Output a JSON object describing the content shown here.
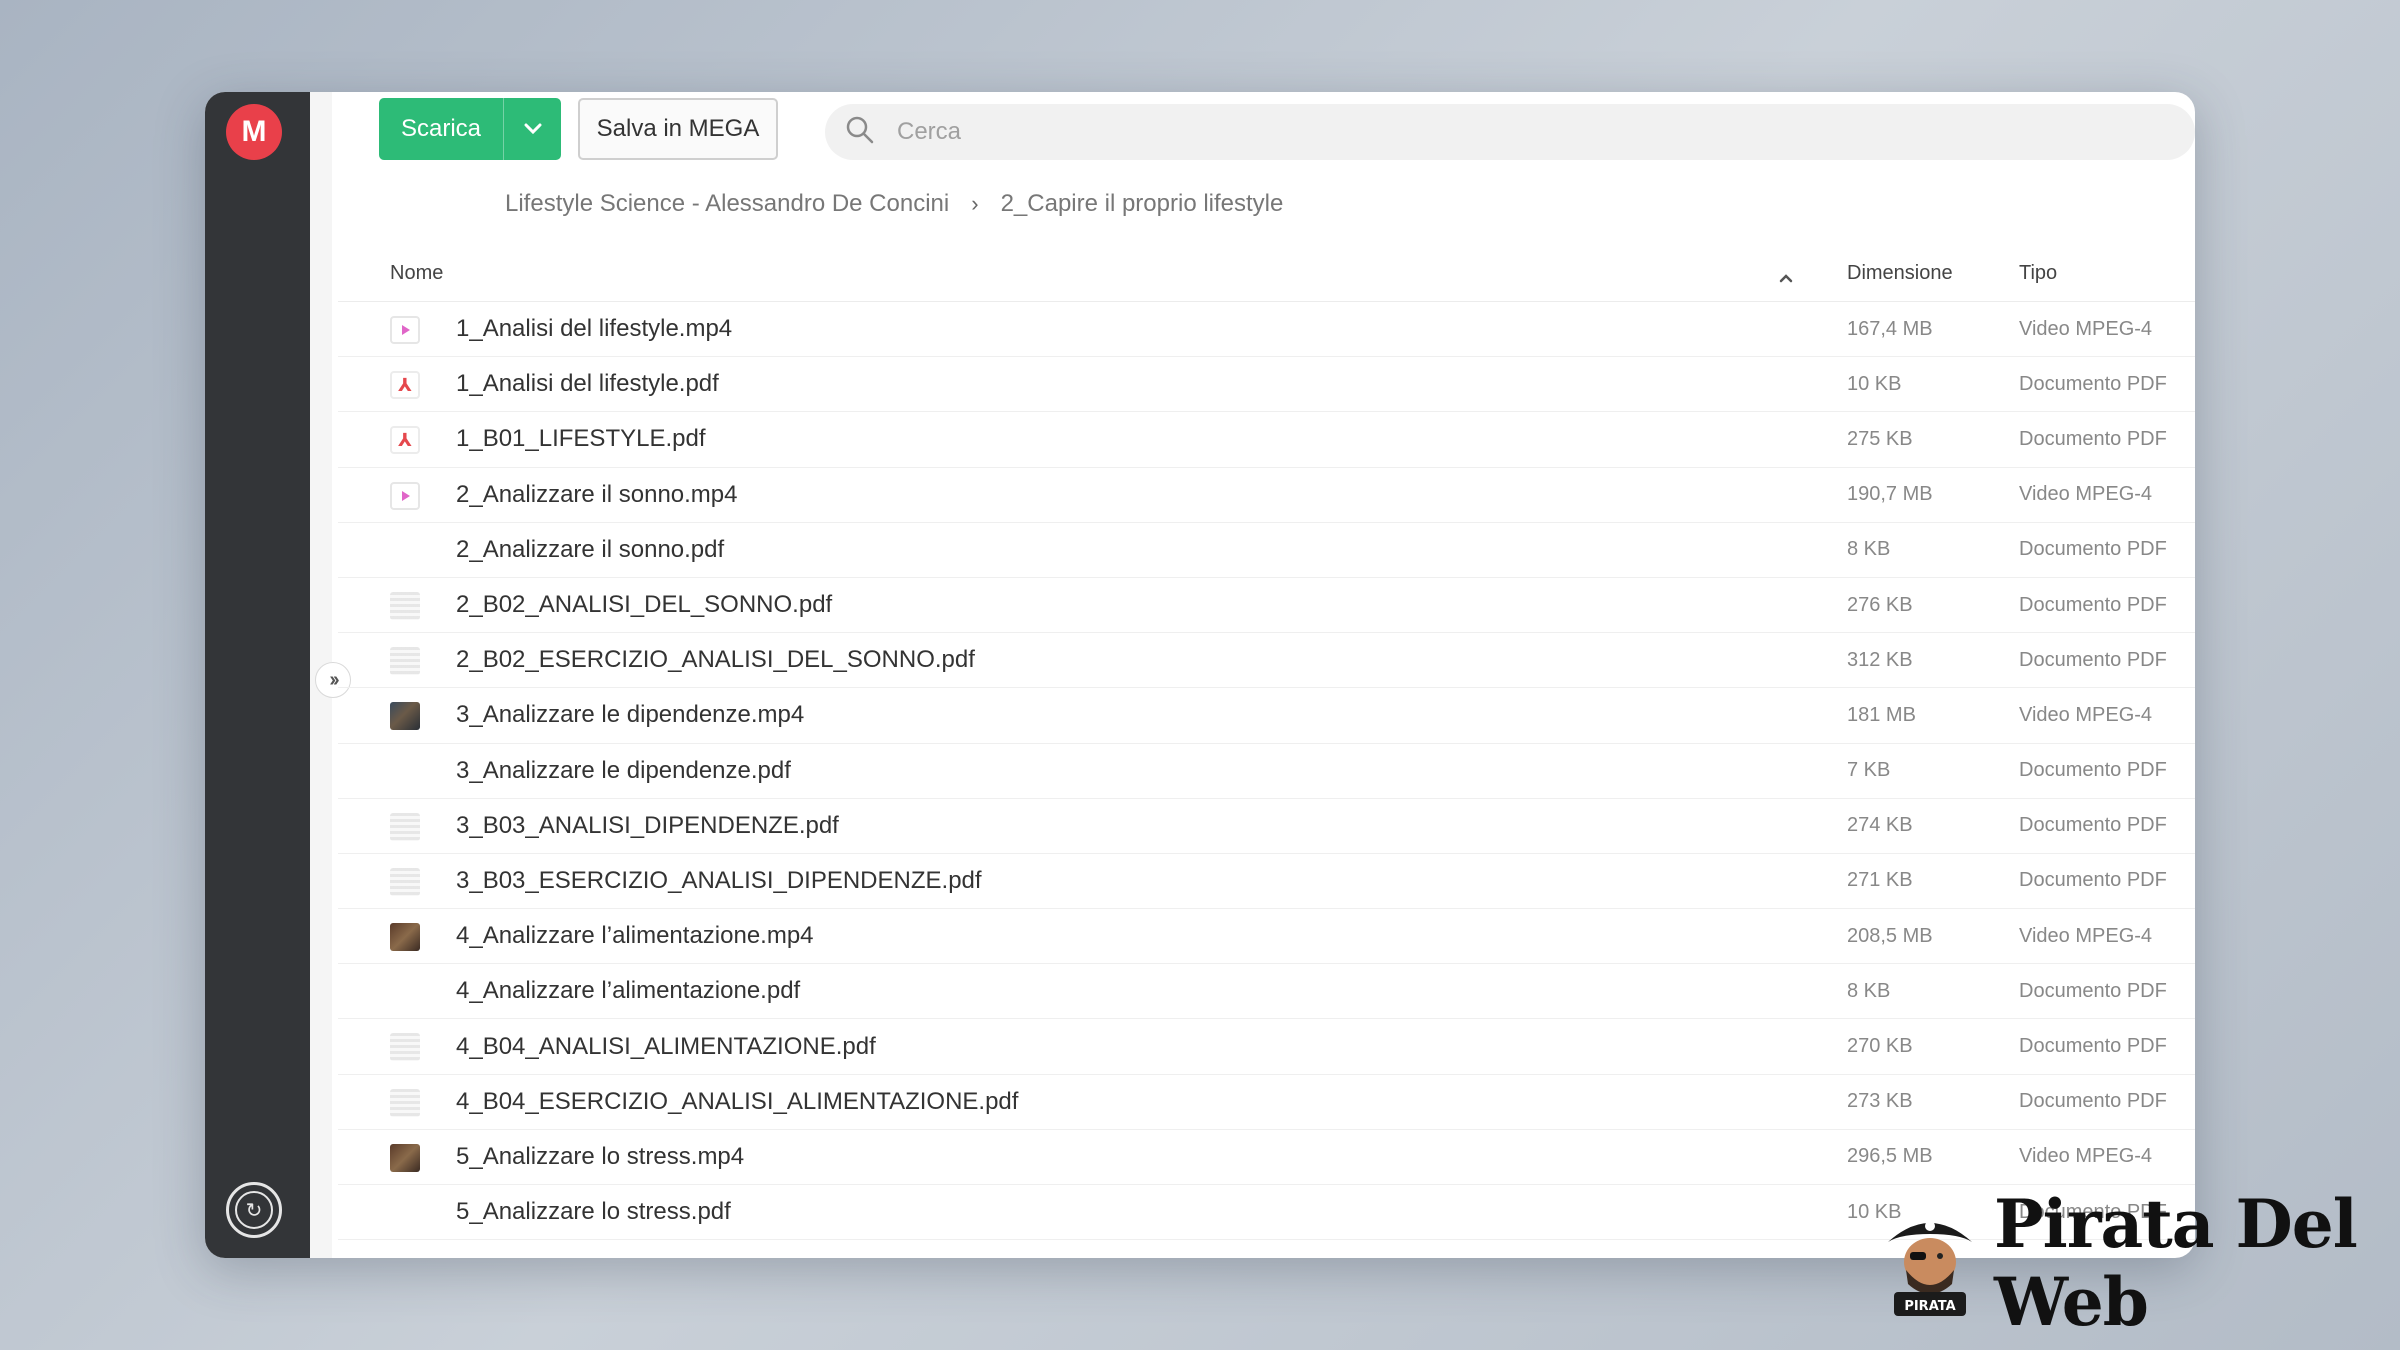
{
  "app": {
    "logo_letter": "M",
    "accent_color": "#2dbb77",
    "logo_color": "#e9404a"
  },
  "toolbar": {
    "download_label": "Scarica",
    "save_label": "Salva in MEGA"
  },
  "search": {
    "placeholder": "Cerca"
  },
  "breadcrumb": {
    "items": [
      "Lifestyle Science - Alessandro De Concini",
      "2_Capire il proprio lifestyle"
    ]
  },
  "columns": {
    "name": "Nome",
    "size": "Dimensione",
    "type": "Tipo"
  },
  "files": [
    {
      "name": "1_Analisi del lifestyle.mp4",
      "size": "167,4 MB",
      "type": "Video MPEG-4",
      "icon": "video-file-icon"
    },
    {
      "name": "1_Analisi del lifestyle.pdf",
      "size": "10 KB",
      "type": "Documento PDF",
      "icon": "pdf-file-icon"
    },
    {
      "name": "1_B01_LIFESTYLE.pdf",
      "size": "275 KB",
      "type": "Documento PDF",
      "icon": "pdf-file-icon"
    },
    {
      "name": "2_Analizzare il sonno.mp4",
      "size": "190,7 MB",
      "type": "Video MPEG-4",
      "icon": "video-file-icon"
    },
    {
      "name": "2_Analizzare il sonno.pdf",
      "size": "8 KB",
      "type": "Documento PDF",
      "icon": "blank-thumbnail"
    },
    {
      "name": "2_B02_ANALISI_DEL_SONNO.pdf",
      "size": "276 KB",
      "type": "Documento PDF",
      "icon": "document-thumbnail"
    },
    {
      "name": "2_B02_ESERCIZIO_ANALISI_DEL_SONNO.pdf",
      "size": "312 KB",
      "type": "Documento PDF",
      "icon": "document-thumbnail"
    },
    {
      "name": "3_Analizzare le dipendenze.mp4",
      "size": "181 MB",
      "type": "Video MPEG-4",
      "icon": "video-thumbnail"
    },
    {
      "name": "3_Analizzare le dipendenze.pdf",
      "size": "7 KB",
      "type": "Documento PDF",
      "icon": "blank-thumbnail"
    },
    {
      "name": "3_B03_ANALISI_DIPENDENZE.pdf",
      "size": "274 KB",
      "type": "Documento PDF",
      "icon": "document-thumbnail"
    },
    {
      "name": "3_B03_ESERCIZIO_ANALISI_DIPENDENZE.pdf",
      "size": "271 KB",
      "type": "Documento PDF",
      "icon": "document-thumbnail"
    },
    {
      "name": "4_Analizzare l’alimentazione.mp4",
      "size": "208,5 MB",
      "type": "Video MPEG-4",
      "icon": "video-thumbnail-2"
    },
    {
      "name": "4_Analizzare l’alimentazione.pdf",
      "size": "8 KB",
      "type": "Documento PDF",
      "icon": "blank-thumbnail"
    },
    {
      "name": "4_B04_ANALISI_ALIMENTAZIONE.pdf",
      "size": "270 KB",
      "type": "Documento PDF",
      "icon": "document-thumbnail"
    },
    {
      "name": "4_B04_ESERCIZIO_ANALISI_ALIMENTAZIONE.pdf",
      "size": "273 KB",
      "type": "Documento PDF",
      "icon": "document-thumbnail"
    },
    {
      "name": "5_Analizzare lo stress.mp4",
      "size": "296,5 MB",
      "type": "Video MPEG-4",
      "icon": "video-thumbnail-2"
    },
    {
      "name": "5_Analizzare lo stress.pdf",
      "size": "10 KB",
      "type": "Documento PDF",
      "icon": "blank-thumbnail"
    }
  ],
  "watermark": {
    "brand_text": "Pirata Del Web",
    "badge_text": "PIRATA"
  }
}
